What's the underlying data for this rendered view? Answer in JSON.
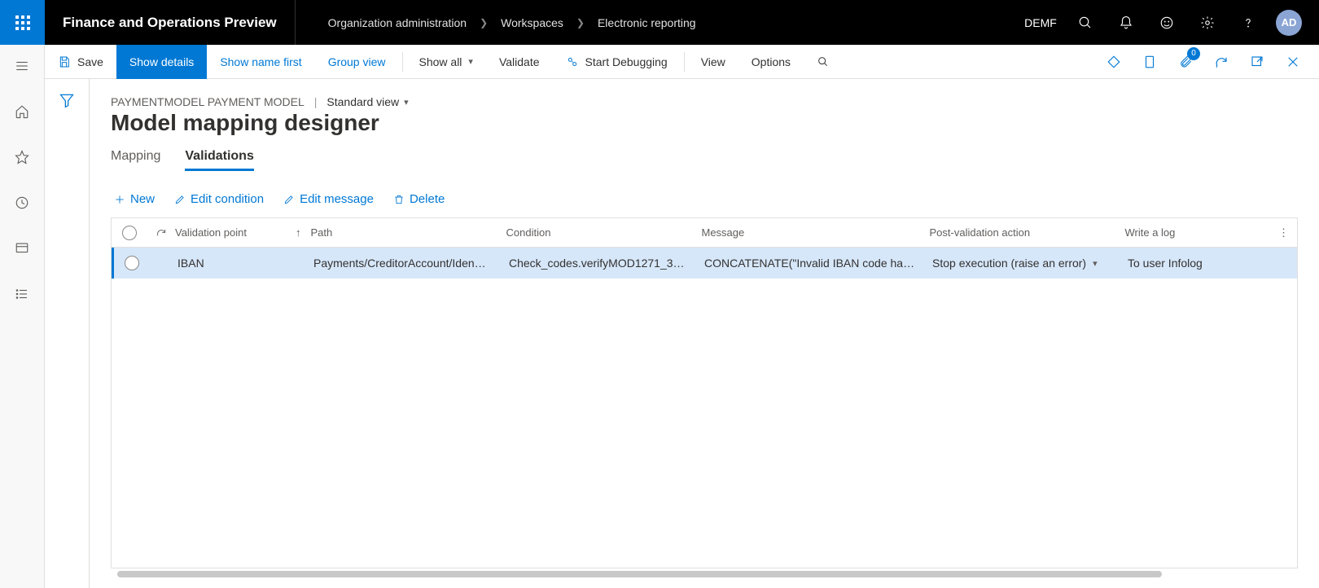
{
  "header": {
    "app_title": "Finance and Operations Preview",
    "breadcrumb": [
      "Organization administration",
      "Workspaces",
      "Electronic reporting"
    ],
    "entity": "DEMF",
    "avatar": "AD"
  },
  "action_bar": {
    "save": "Save",
    "show_details": "Show details",
    "show_name_first": "Show name first",
    "group_view": "Group view",
    "show_all": "Show all",
    "validate": "Validate",
    "start_debugging": "Start Debugging",
    "view": "View",
    "options": "Options",
    "attachments_badge": "0"
  },
  "page": {
    "breadcrumb_label": "PAYMENTMODEL PAYMENT MODEL",
    "view_name": "Standard view",
    "title": "Model mapping designer",
    "tabs": {
      "mapping": "Mapping",
      "validations": "Validations"
    }
  },
  "grid_actions": {
    "new": "New",
    "edit_condition": "Edit condition",
    "edit_message": "Edit message",
    "delete": "Delete"
  },
  "grid": {
    "columns": {
      "validation_point": "Validation point",
      "path": "Path",
      "condition": "Condition",
      "message": "Message",
      "post_action": "Post-validation action",
      "write_log": "Write a log"
    },
    "rows": [
      {
        "validation_point": "IBAN",
        "path": "Payments/CreditorAccount/Iden…",
        "condition": "Check_codes.verifyMOD1271_3…",
        "message": "CONCATENATE(\"Invalid IBAN code ha…",
        "post_action": "Stop execution (raise an error)",
        "write_log": "To user Infolog"
      }
    ]
  }
}
